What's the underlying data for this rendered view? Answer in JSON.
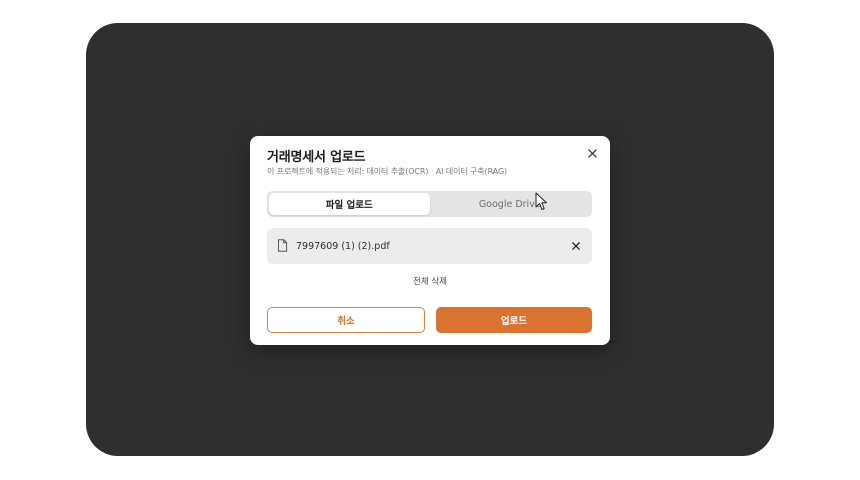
{
  "modal": {
    "title": "거래명세서 업로드",
    "subtitle": "이 프로젝트에 적용되는 처리: 데이터 추출(OCR) · AI 데이터 구축(RAG)"
  },
  "tabs": [
    {
      "label": "파일 업로드",
      "active": true
    },
    {
      "label": "Google Drive",
      "active": false
    }
  ],
  "files": [
    {
      "name": "7997609 (1) (2).pdf"
    }
  ],
  "clear_all_label": "전체 삭제",
  "buttons": {
    "cancel_label": "취소",
    "upload_label": "업로드"
  },
  "icons": {
    "close": "close-icon",
    "file": "file-icon",
    "remove": "remove-file-icon",
    "cursor": "mouse-pointer-icon"
  },
  "colors": {
    "accent": "#d9732f",
    "backdrop": "#2f2f2f"
  }
}
